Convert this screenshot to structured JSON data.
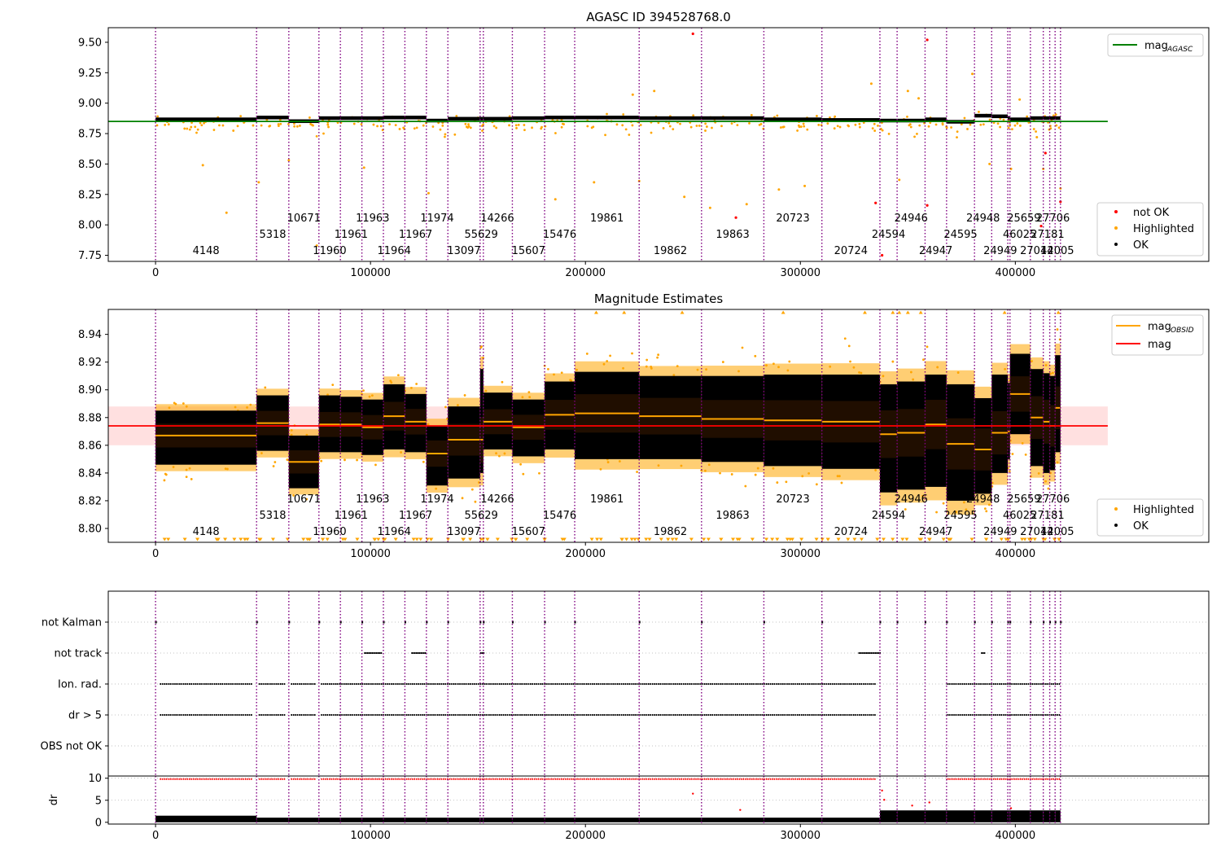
{
  "chart_data": [
    {
      "type": "scatter",
      "title": "AGASC ID 394528768.0",
      "xlabel": "",
      "ylabel": "",
      "xlim": [
        -22000,
        490000
      ],
      "ylim": [
        7.7,
        9.62
      ],
      "xticks": [
        0,
        100000,
        200000,
        300000,
        400000
      ],
      "xtick_labels": [
        "0",
        "100000",
        "200000",
        "300000",
        "400000"
      ],
      "yticks": [
        7.75,
        8.0,
        8.25,
        8.5,
        8.75,
        9.0,
        9.25,
        9.5
      ],
      "ytick_labels": [
        "7.75",
        "8.00",
        "8.25",
        "8.50",
        "8.75",
        "9.00",
        "9.25",
        "9.50"
      ],
      "reference_line": {
        "name": "mag_AGASC",
        "value": 8.85,
        "x_end": 443000,
        "color": "#008000"
      },
      "legend_top": {
        "position": "upper right",
        "entries": [
          {
            "label": "mag",
            "subscript": "AGASC",
            "color": "#008000",
            "kind": "line"
          }
        ]
      },
      "legend_bottom": {
        "position": "lower right",
        "entries": [
          {
            "label": "not OK",
            "color": "#ff0000",
            "kind": "point"
          },
          {
            "label": "Highlighted",
            "color": "#ffa500",
            "kind": "point"
          },
          {
            "label": "OK",
            "color": "#000000",
            "kind": "point"
          }
        ]
      },
      "series": [
        {
          "name": "OK",
          "color": "#000000",
          "segment_levels": [
            8.87,
            8.885,
            8.855,
            8.88,
            8.88,
            8.88,
            8.885,
            8.885,
            8.86,
            8.875,
            8.875,
            8.875,
            8.88,
            8.885,
            8.885,
            8.88,
            8.88,
            8.87,
            8.865,
            8.86,
            8.86,
            8.87,
            8.85,
            8.9,
            8.895,
            8.88,
            8.87,
            8.88
          ],
          "band_halfwidth": 0.02
        },
        {
          "name": "Highlighted",
          "color": "#ffa500",
          "points": [
            [
              22000,
              8.49
            ],
            [
              33000,
              8.1
            ],
            [
              48000,
              8.35
            ],
            [
              62000,
              8.53
            ],
            [
              75000,
              7.83
            ],
            [
              97000,
              8.47
            ],
            [
              127000,
              8.26
            ],
            [
              150000,
              8.88
            ],
            [
              186000,
              8.21
            ],
            [
              204000,
              8.35
            ],
            [
              222000,
              9.07
            ],
            [
              225000,
              8.36
            ],
            [
              232000,
              9.1
            ],
            [
              246000,
              8.23
            ],
            [
              258000,
              8.14
            ],
            [
              275000,
              8.17
            ],
            [
              290000,
              8.29
            ],
            [
              302000,
              8.32
            ],
            [
              333000,
              9.16
            ],
            [
              346000,
              8.37
            ],
            [
              350000,
              9.1
            ],
            [
              355000,
              9.04
            ],
            [
              380000,
              9.24
            ],
            [
              388000,
              8.5
            ],
            [
              398000,
              8.46
            ],
            [
              402000,
              9.03
            ],
            [
              410000,
              8.72
            ],
            [
              413000,
              8.46
            ],
            [
              421000,
              8.3
            ]
          ]
        },
        {
          "name": "not OK",
          "color": "#ff0000",
          "points": [
            [
              250000,
              9.57
            ],
            [
              359000,
              9.52
            ],
            [
              270000,
              8.06
            ],
            [
              335000,
              8.18
            ],
            [
              359000,
              8.16
            ],
            [
              421000,
              8.19
            ],
            [
              412000,
              7.99
            ],
            [
              338000,
              7.75
            ],
            [
              414000,
              8.59
            ]
          ]
        }
      ]
    },
    {
      "type": "scatter",
      "title": "Magnitude Estimates",
      "xlabel": "",
      "ylabel": "",
      "xlim": [
        -22000,
        490000
      ],
      "ylim": [
        8.79,
        8.958
      ],
      "xticks": [
        0,
        100000,
        200000,
        300000,
        400000
      ],
      "xtick_labels": [
        "0",
        "100000",
        "200000",
        "300000",
        "400000"
      ],
      "yticks": [
        8.8,
        8.82,
        8.84,
        8.86,
        8.88,
        8.9,
        8.92,
        8.94
      ],
      "ytick_labels": [
        "8.80",
        "8.82",
        "8.84",
        "8.86",
        "8.88",
        "8.90",
        "8.92",
        "8.94"
      ],
      "mag_line": {
        "name": "mag",
        "value": 8.874,
        "band": [
          8.86,
          8.888
        ],
        "x_end": 443000,
        "color": "#ff0000"
      },
      "legend_top": {
        "position": "upper right",
        "entries": [
          {
            "label": "mag",
            "subscript": "OBSID",
            "color": "#ffa500",
            "kind": "line"
          },
          {
            "label": "mag",
            "subscript": "",
            "color": "#ff0000",
            "kind": "line"
          }
        ]
      },
      "legend_bottom": {
        "position": "lower right",
        "entries": [
          {
            "label": "Highlighted",
            "color": "#ffa500",
            "kind": "point"
          },
          {
            "label": "OK",
            "color": "#000000",
            "kind": "point"
          }
        ]
      },
      "segments": [
        {
          "obsid": "4148",
          "x0": 0,
          "x1": 47000,
          "mean": 8.867,
          "lo": 8.846,
          "hi": 8.885
        },
        {
          "obsid": "5318",
          "x0": 47000,
          "x1": 62000,
          "mean": 8.876,
          "lo": 8.856,
          "hi": 8.896
        },
        {
          "obsid": "10671",
          "x0": 62000,
          "x1": 76000,
          "mean": 8.848,
          "lo": 8.829,
          "hi": 8.867
        },
        {
          "obsid": "11960",
          "x0": 76000,
          "x1": 86000,
          "mean": 8.875,
          "lo": 8.855,
          "hi": 8.896
        },
        {
          "obsid": "11961",
          "x0": 86000,
          "x1": 96000,
          "mean": 8.875,
          "lo": 8.855,
          "hi": 8.895
        },
        {
          "obsid": "11963",
          "x0": 96000,
          "x1": 106000,
          "mean": 8.873,
          "lo": 8.853,
          "hi": 8.893
        },
        {
          "obsid": "11964",
          "x0": 106000,
          "x1": 116000,
          "mean": 8.881,
          "lo": 8.857,
          "hi": 8.904
        },
        {
          "obsid": "11967",
          "x0": 116000,
          "x1": 126000,
          "mean": 8.877,
          "lo": 8.855,
          "hi": 8.897
        },
        {
          "obsid": "11974",
          "x0": 126000,
          "x1": 136000,
          "mean": 8.854,
          "lo": 8.831,
          "hi": 8.874
        },
        {
          "obsid": "13097",
          "x0": 136000,
          "x1": 151000,
          "mean": 8.864,
          "lo": 8.836,
          "hi": 8.888
        },
        {
          "obsid": "55629",
          "x0": 151000,
          "x1": 152500,
          "mean": 8.864,
          "lo": 8.84,
          "hi": 8.915
        },
        {
          "obsid": "14266",
          "x0": 152500,
          "x1": 166000,
          "mean": 8.877,
          "lo": 8.857,
          "hi": 8.898
        },
        {
          "obsid": "15607",
          "x0": 166000,
          "x1": 181000,
          "mean": 8.873,
          "lo": 8.852,
          "hi": 8.893
        },
        {
          "obsid": "15476",
          "x0": 181000,
          "x1": 195000,
          "mean": 8.882,
          "lo": 8.857,
          "hi": 8.906
        },
        {
          "obsid": "19861",
          "x0": 195000,
          "x1": 225000,
          "mean": 8.883,
          "lo": 8.85,
          "hi": 8.913
        },
        {
          "obsid": "19862",
          "x0": 225000,
          "x1": 254000,
          "mean": 8.881,
          "lo": 8.85,
          "hi": 8.91
        },
        {
          "obsid": "19863",
          "x0": 254000,
          "x1": 283000,
          "mean": 8.879,
          "lo": 8.848,
          "hi": 8.91
        },
        {
          "obsid": "20723",
          "x0": 283000,
          "x1": 310000,
          "mean": 8.878,
          "lo": 8.845,
          "hi": 8.911
        },
        {
          "obsid": "20724",
          "x0": 310000,
          "x1": 337000,
          "mean": 8.877,
          "lo": 8.843,
          "hi": 8.911
        },
        {
          "obsid": "24594",
          "x0": 337000,
          "x1": 345000,
          "mean": 8.868,
          "lo": 8.826,
          "hi": 8.904
        },
        {
          "obsid": "24946",
          "x0": 345000,
          "x1": 358000,
          "mean": 8.869,
          "lo": 8.828,
          "hi": 8.906
        },
        {
          "obsid": "24947",
          "x0": 358000,
          "x1": 368000,
          "mean": 8.875,
          "lo": 8.83,
          "hi": 8.911
        },
        {
          "obsid": "24595",
          "x0": 368000,
          "x1": 381000,
          "mean": 8.861,
          "lo": 8.82,
          "hi": 8.904
        },
        {
          "obsid": "24948",
          "x0": 381000,
          "x1": 389000,
          "mean": 8.857,
          "lo": 8.825,
          "hi": 8.894
        },
        {
          "obsid": "24949",
          "x0": 389000,
          "x1": 396500,
          "mean": 8.869,
          "lo": 8.84,
          "hi": 8.911
        },
        {
          "obsid": "25659",
          "x0": 396500,
          "x1": 397500,
          "mean": 8.87,
          "lo": 8.85,
          "hi": 8.905
        },
        {
          "obsid": "46025",
          "x0": 397500,
          "x1": 407000,
          "mean": 8.897,
          "lo": 8.868,
          "hi": 8.926
        },
        {
          "obsid": "27014",
          "x0": 407000,
          "x1": 413000,
          "mean": 8.88,
          "lo": 8.845,
          "hi": 8.915
        },
        {
          "obsid": "27181",
          "x0": 413000,
          "x1": 416000,
          "mean": 8.877,
          "lo": 8.84,
          "hi": 8.912
        },
        {
          "obsid": "27706",
          "x0": 416000,
          "x1": 418500,
          "mean": 8.874,
          "lo": 8.842,
          "hi": 8.91
        },
        {
          "obsid": "42005",
          "x0": 418500,
          "x1": 421000,
          "mean": 8.887,
          "lo": 8.855,
          "hi": 8.925
        }
      ]
    },
    {
      "type": "scatter",
      "title": "",
      "xlabel": "",
      "ylabel": "",
      "xlim": [
        -22000,
        490000
      ],
      "categories": [
        "not Kalman",
        "not track",
        "Ion. rad.",
        "dr > 5",
        "OBS not OK"
      ],
      "flag_rows": [
        {
          "label": "not Kalman",
          "pattern": "boundaries"
        },
        {
          "label": "not track",
          "ranges": [
            [
              97000,
              105000
            ],
            [
              119000,
              126000
            ],
            [
              151000,
              152500
            ],
            [
              327000,
              337000
            ],
            [
              384000,
              386000
            ]
          ]
        },
        {
          "label": "Ion. rad.",
          "pattern": "gaps",
          "gaps": [
            [
              337000,
              368000
            ]
          ]
        },
        {
          "label": "dr > 5",
          "pattern": "gaps",
          "gaps": [
            [
              337000,
              368000
            ]
          ]
        },
        {
          "label": "OBS not OK",
          "pattern": "empty"
        }
      ]
    },
    {
      "type": "scatter",
      "title": "",
      "xlabel": "",
      "ylabel": "dr",
      "xlim": [
        -22000,
        490000
      ],
      "ylim": [
        -0.4,
        10.5
      ],
      "xticks": [
        0,
        100000,
        200000,
        300000,
        400000
      ],
      "xtick_labels": [
        "0",
        "100000",
        "200000",
        "300000",
        "400000"
      ],
      "yticks": [
        0,
        5,
        10
      ],
      "ytick_labels": [
        "0",
        "5",
        "10"
      ],
      "series": [
        {
          "name": "dr",
          "color": "#000000",
          "baseline_levels": [
            0.8,
            0.2,
            0.2,
            0.4,
            0.5,
            0.6,
            1.6,
            2.2,
            1.8
          ]
        },
        {
          "name": "dr clipped",
          "color": "#ff0000",
          "value": 9.8
        }
      ]
    }
  ],
  "obsid_boundaries": [
    0,
    47000,
    62000,
    76000,
    86000,
    96000,
    106000,
    116000,
    126000,
    136000,
    151000,
    152500,
    166000,
    181000,
    195000,
    225000,
    254000,
    283000,
    310000,
    337000,
    345000,
    358000,
    368000,
    381000,
    389000,
    396500,
    397500,
    407000,
    413000,
    416000,
    418500,
    421000
  ],
  "obsid_labels": [
    {
      "text": "4148",
      "x": 23500,
      "row": 2
    },
    {
      "text": "5318",
      "x": 54500,
      "row": 1
    },
    {
      "text": "10671",
      "x": 69000,
      "row": 0
    },
    {
      "text": "11960",
      "x": 81000,
      "row": 2
    },
    {
      "text": "11961",
      "x": 91000,
      "row": 1
    },
    {
      "text": "11963",
      "x": 101000,
      "row": 0
    },
    {
      "text": "11964",
      "x": 111000,
      "row": 2
    },
    {
      "text": "11967",
      "x": 121000,
      "row": 1
    },
    {
      "text": "11974",
      "x": 131000,
      "row": 0
    },
    {
      "text": "13097",
      "x": 143500,
      "row": 2
    },
    {
      "text": "55629",
      "x": 151500,
      "row": 1
    },
    {
      "text": "14266",
      "x": 159000,
      "row": 0
    },
    {
      "text": "15607",
      "x": 173500,
      "row": 2
    },
    {
      "text": "15476",
      "x": 188000,
      "row": 1
    },
    {
      "text": "19861",
      "x": 210000,
      "row": 0
    },
    {
      "text": "19862",
      "x": 239500,
      "row": 2
    },
    {
      "text": "19863",
      "x": 268500,
      "row": 1
    },
    {
      "text": "20723",
      "x": 296500,
      "row": 0
    },
    {
      "text": "20724",
      "x": 323500,
      "row": 2
    },
    {
      "text": "24594",
      "x": 341000,
      "row": 1
    },
    {
      "text": "24946",
      "x": 351500,
      "row": 0
    },
    {
      "text": "24947",
      "x": 363000,
      "row": 2
    },
    {
      "text": "24595",
      "x": 374500,
      "row": 1
    },
    {
      "text": "24948",
      "x": 385000,
      "row": 0
    },
    {
      "text": "24949",
      "x": 393000,
      "row": 2
    },
    {
      "text": "46025",
      "x": 402000,
      "row": 1
    },
    {
      "text": "25659",
      "x": 404000,
      "row": 0
    },
    {
      "text": "27014",
      "x": 410000,
      "row": 2
    },
    {
      "text": "27181",
      "x": 415000,
      "row": 1
    },
    {
      "text": "27706",
      "x": 417500,
      "row": 0
    },
    {
      "text": "42005",
      "x": 419500,
      "row": 2
    }
  ],
  "colors": {
    "ok": "#000000",
    "highlighted": "#ffa500",
    "not_ok": "#ff0000",
    "agasc_line": "#008000",
    "mag_line": "#ff0000",
    "boundary": "#800080"
  }
}
